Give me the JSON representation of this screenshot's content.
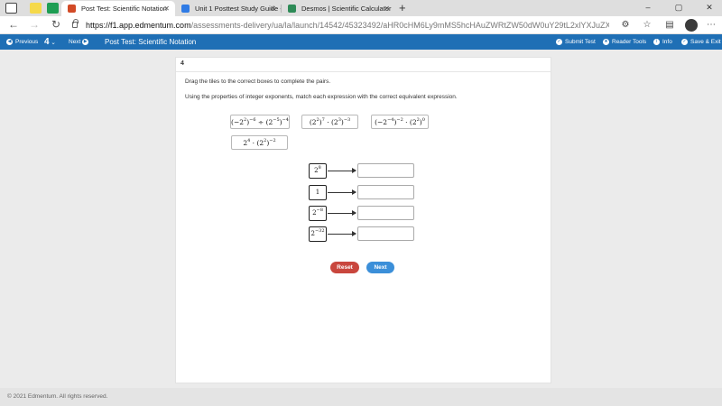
{
  "tabs": [
    {
      "title": "Post Test: Scientific Notation",
      "active": true,
      "favicon_color": "#d24a26"
    },
    {
      "title": "Unit 1 Posttest Study Guide - Go",
      "active": false,
      "favicon_color": "#2f7be5"
    },
    {
      "title": "Desmos | Scientific Calculator",
      "active": false,
      "favicon_color": "#2e8b57"
    }
  ],
  "window_controls": {
    "minimize": "–",
    "maximize": "▢",
    "close": "✕"
  },
  "address_bar": {
    "url_host": "https://f1.app.edmentum.com",
    "url_path": "/assessments-delivery/ua/la/launch/14542/45323492/aHR0cHM6Ly9mMS5hcHAuZWRtZW50dW0uY29tL2xlYXJuZXItdWk..."
  },
  "toolbar": {
    "previous_label": "Previous",
    "page_number": "4",
    "next_label": "Next",
    "title": "Post Test: Scientific Notation",
    "submit_label": "Submit Test",
    "reader_label": "Reader Tools",
    "info_label": "Info",
    "save_exit_label": "Save & Exit",
    "accent_color": "#1f6fb5"
  },
  "question": {
    "number": "4",
    "instruction_1": "Drag the tiles to the correct boxes to complete the pairs.",
    "instruction_2": "Using the properties of integer exponents, match each expression with the correct equivalent expression."
  },
  "tiles": {
    "t1": {
      "a": "(−2",
      "a_exp": "2",
      "b": ")",
      "b_exp": "−6",
      "c": " ÷ (2",
      "c_exp": "−5",
      "d": ")",
      "d_exp": "−4"
    },
    "t2": {
      "a": "(2",
      "a_exp": "2",
      "b": ")",
      "b_exp": "7",
      "c": " · (2",
      "c_exp": "3",
      "d": ")",
      "d_exp": "−3"
    },
    "t3": {
      "a": "(−2",
      "a_exp": "−4",
      "b": ")",
      "b_exp": "−2",
      "c": " · (2",
      "c_exp": "2",
      "d": ")",
      "d_exp": "0"
    },
    "t4": {
      "a": "2",
      "a_exp": "4",
      "c": " · (2",
      "c_exp": "2",
      "d": ")",
      "d_exp": "−2"
    }
  },
  "pairs": [
    {
      "base": "2",
      "exp": "8"
    },
    {
      "base": "1",
      "exp": ""
    },
    {
      "base": "2",
      "exp": "−8"
    },
    {
      "base": "2",
      "exp": "−32"
    }
  ],
  "buttons": {
    "reset": "Reset",
    "next": "Next"
  },
  "footer": {
    "copyright": "© 2021 Edmentum. All rights reserved."
  }
}
